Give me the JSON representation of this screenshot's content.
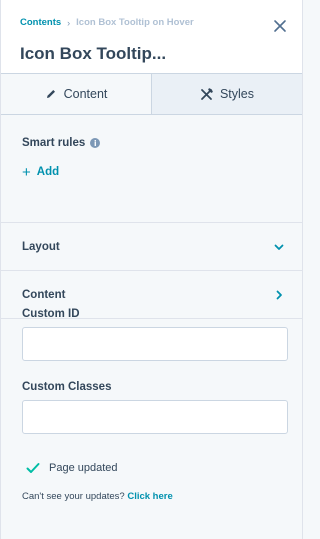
{
  "header": {
    "breadcrumb_root": "Contents",
    "breadcrumb_separator": "›",
    "breadcrumb_current": "Icon Box Tooltip on Hover",
    "title": "Icon Box Tooltip..."
  },
  "tabs": [
    {
      "label": "Content",
      "icon": "pencil-icon",
      "active": true
    },
    {
      "label": "Styles",
      "icon": "styles-icon",
      "active": false
    }
  ],
  "smart_rules": {
    "label": "Smart rules",
    "add_label": "Add"
  },
  "accordions": [
    {
      "label": "Layout",
      "icon": "chevron-down-icon"
    },
    {
      "label": "Content",
      "icon": "chevron-right-icon"
    }
  ],
  "fields": {
    "custom_id": {
      "label": "Custom ID",
      "value": ""
    },
    "custom_classes": {
      "label": "Custom Classes",
      "value": ""
    }
  },
  "status": {
    "text": "Page updated",
    "icon": "checkmark-icon"
  },
  "help": {
    "text": "Can't see your updates?",
    "link": "Click here"
  },
  "colors": {
    "accent": "#0091ae",
    "text": "#33475b",
    "success": "#00bda5",
    "muted": "#b0c1d4"
  }
}
